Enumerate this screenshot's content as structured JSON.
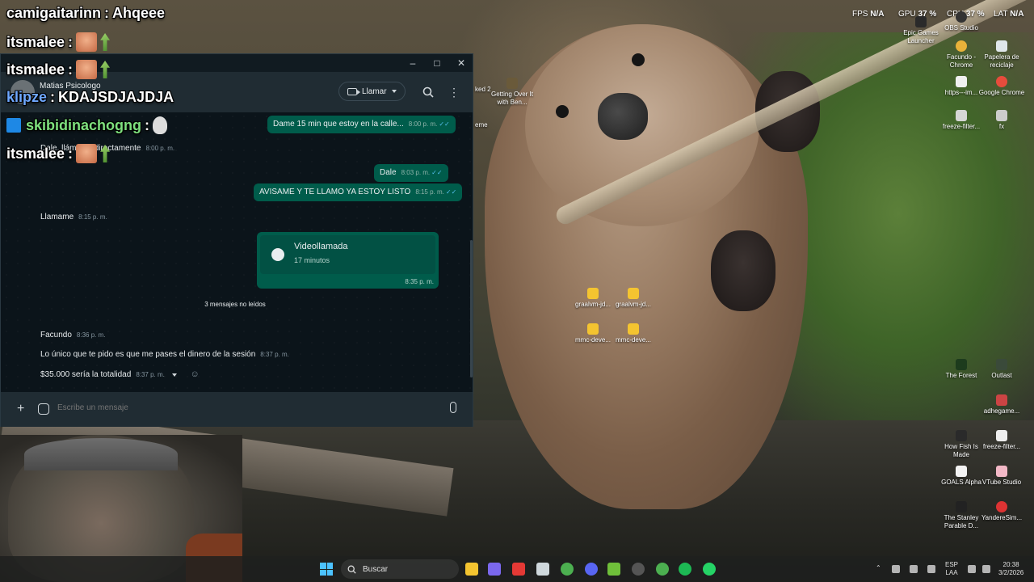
{
  "overlay_chat": [
    {
      "user": "camigaitarinn",
      "message": "Ahqeee"
    },
    {
      "user": "itsmalee",
      "message": ""
    },
    {
      "user": "itsmalee",
      "message": ""
    },
    {
      "user": "klipze",
      "message": "KDAJSDJAJDJA"
    },
    {
      "user": "skibidinachogng",
      "message": ""
    },
    {
      "user": "itsmalee",
      "message": ""
    }
  ],
  "whatsapp": {
    "contact_name": "Matias Psicologo",
    "call_label": "Llamar",
    "messages": [
      {
        "dir": "out",
        "text": "Dame 15 min que estoy en la calle...",
        "time": "8:00 p. m."
      },
      {
        "dir": "in",
        "text": "Dale, llámame directamente",
        "time": "8:00 p. m."
      },
      {
        "dir": "out",
        "text": "Dale",
        "time": "8:03 p. m."
      },
      {
        "dir": "out",
        "text": "AVISAME Y TE LLAMO YA ESTOY LISTO",
        "time": "8:15 p. m."
      },
      {
        "dir": "in",
        "text": "Llamame",
        "time": "8:15 p. m."
      }
    ],
    "video_call": {
      "title": "Videollamada",
      "duration": "17 minutos",
      "time": "8:35 p. m."
    },
    "unread_divider": "3 mensajes no leídos",
    "sender": "Facundo",
    "sender_time": "8:36 p. m.",
    "unread_messages": [
      {
        "text": "Lo único que te pido es que me pases el dinero de la sesión",
        "time": "8:37 p. m."
      },
      {
        "text": "$35.000 sería la totalidad",
        "time": "8:37 p. m."
      }
    ],
    "input_placeholder": "Escribe un mensaje"
  },
  "perf_overlay": {
    "fps_label": "FPS",
    "fps_value": "N/A",
    "gpu_label": "GPU",
    "gpu_value": "37 %",
    "cpu_label": "CPU",
    "cpu_value": "37 %",
    "lat_label": "LAT",
    "lat_value": "N/A"
  },
  "desktop_icons": [
    "Epic Games Launcher",
    "OBS Studio",
    "Facundo - Chrome",
    "Papelera de reciclaje",
    "https---im...",
    "Google Chrome",
    "freeze-filter...",
    "fx",
    "The Forest",
    "Outlast",
    "adhegame...",
    "How Fish Is Made",
    "freeze-filter...",
    "GOALS Alpha",
    "VTube Studio",
    "The Stanley Parable D...",
    "YandereSim...",
    "Getting Over It with Ben...",
    "graalvm-jd...",
    "graalvm-jd...",
    "mmc-deve...",
    "mmc-deve..."
  ],
  "taskbar": {
    "search_label": "Buscar",
    "language": "ESP",
    "layout": "LAA",
    "time": "20:38",
    "date": "3/2/2026"
  },
  "colors": {
    "wa_bg": "#0b141a",
    "wa_header": "#202c33",
    "wa_out_bubble": "#005c4b",
    "accent_ticks": "#53bdeb"
  }
}
